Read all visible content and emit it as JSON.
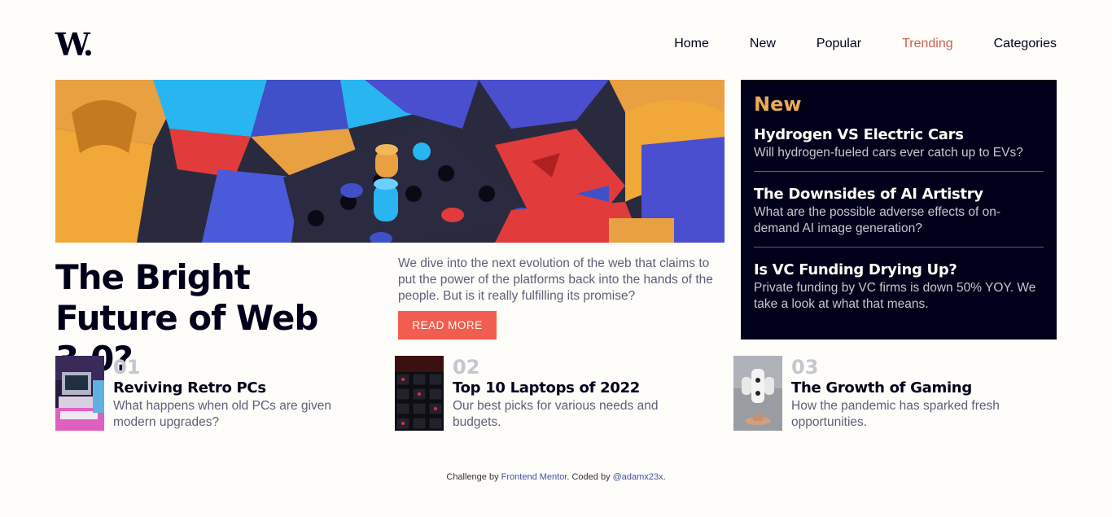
{
  "header": {
    "logo": "W.",
    "nav": [
      "Home",
      "New",
      "Popular",
      "Trending",
      "Categories"
    ],
    "active_nav": "Trending"
  },
  "hero": {
    "image_alt": "colorful 3D geometric blocks",
    "title": "The Bright Future of Web 3.0?",
    "description": "We dive into the next evolution of the web that claims to put the power of the platforms back into the hands of the people. But is it really fulfilling its promise?",
    "button_label": "Read more"
  },
  "new_panel": {
    "heading": "New",
    "items": [
      {
        "title": "Hydrogen VS Electric Cars",
        "description": "Will hydrogen-fueled cars ever catch up to EVs?"
      },
      {
        "title": "The Downsides of AI Artistry",
        "description": "What are the possible adverse effects of on-demand AI image generation?"
      },
      {
        "title": "Is VC Funding Drying Up?",
        "description": "Private funding by VC firms is down 50% YOY. We take a look at what that means."
      }
    ]
  },
  "cards": [
    {
      "number": "01",
      "title": "Reviving Retro PCs",
      "description": "What happens when old PCs are given modern upgrades?"
    },
    {
      "number": "02",
      "title": "Top 10 Laptops of 2022",
      "description": "Our best picks for various needs and budgets."
    },
    {
      "number": "03",
      "title": "The Growth of Gaming",
      "description": "How the pandemic has sparked fresh opportunities."
    }
  ],
  "footer": {
    "prefix": "Challenge by ",
    "link1": "Frontend Mentor",
    "middle": ". Coded by ",
    "link2": "@adamx23x",
    "suffix": "."
  },
  "colors": {
    "accent": "#f15e50",
    "active_nav": "#c8624f",
    "panel_bg": "#00001a",
    "panel_heading": "#e9ab53",
    "muted_text": "#5d5f79",
    "number_text": "#c5c6ce"
  }
}
